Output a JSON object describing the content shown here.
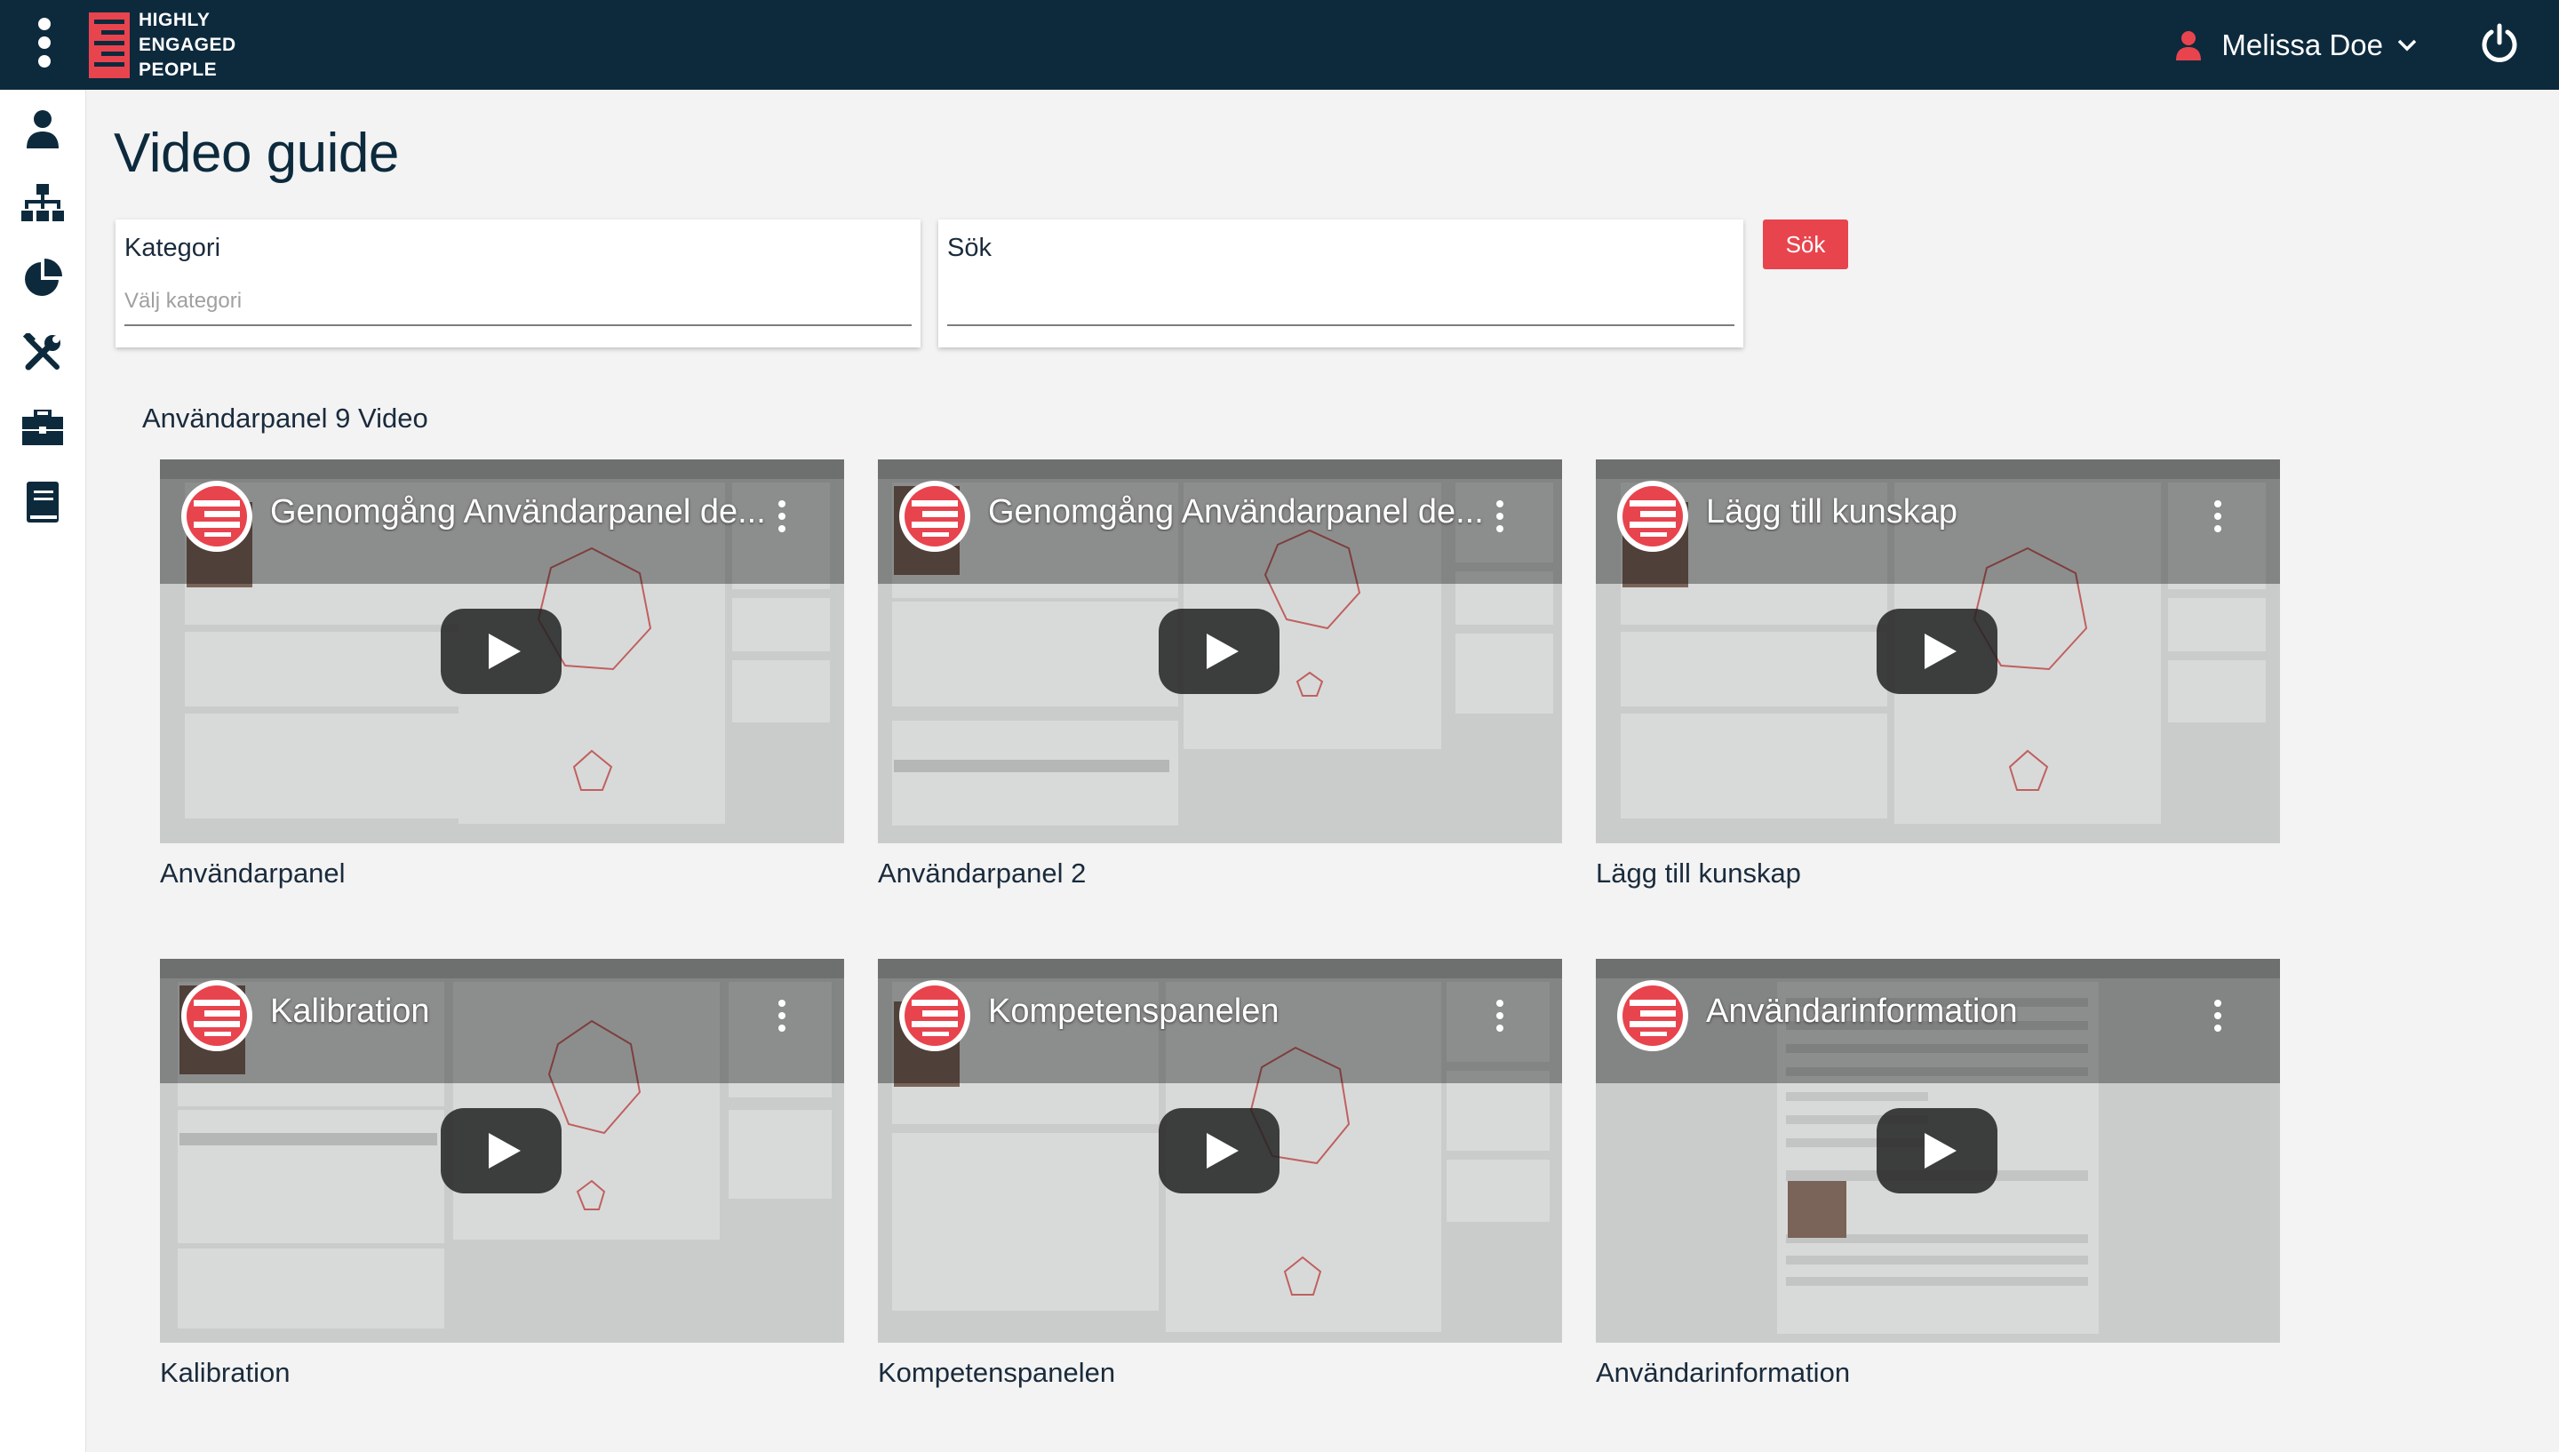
{
  "header": {
    "logo_lines": [
      "HIGHLY",
      "ENGAGED",
      "PEOPLE"
    ],
    "user_name": "Melissa Doe"
  },
  "sidebar": {
    "items": [
      {
        "icon": "user-icon"
      },
      {
        "icon": "org-chart-icon"
      },
      {
        "icon": "pie-chart-icon"
      },
      {
        "icon": "tools-icon"
      },
      {
        "icon": "briefcase-icon"
      },
      {
        "icon": "book-icon"
      }
    ]
  },
  "page": {
    "title": "Video guide"
  },
  "filters": {
    "category_label": "Kategori",
    "category_placeholder": "Välj kategori",
    "search_label": "Sök",
    "search_value": "",
    "search_button": "Sök"
  },
  "section": {
    "title": "Användarpanel 9 Video"
  },
  "videos": [
    {
      "title": "Genomgång Användarpanel de...",
      "caption": "Användarpanel"
    },
    {
      "title": "Genomgång Användarpanel de...",
      "caption": "Användarpanel 2"
    },
    {
      "title": "Lägg till kunskap",
      "caption": "Lägg till kunskap"
    },
    {
      "title": "Kalibration",
      "caption": "Kalibration"
    },
    {
      "title": "Kompetenspanelen",
      "caption": "Kompetenspanelen"
    },
    {
      "title": "Användarinformation",
      "caption": "Användarinformation"
    }
  ],
  "colors": {
    "header_bg": "#0d2a3d",
    "accent": "#e8444e",
    "page_bg": "#f3f3f3"
  }
}
